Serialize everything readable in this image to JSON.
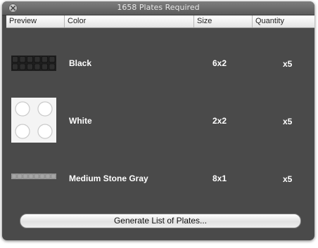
{
  "window": {
    "title": "1658 Plates Required"
  },
  "table": {
    "columns": [
      "Preview",
      "Color",
      "Size",
      "Quantity"
    ],
    "rows": [
      {
        "color": "Black",
        "size": "6x2",
        "quantity": "x5",
        "preview_color": "#1e1e1e"
      },
      {
        "color": "White",
        "size": "2x2",
        "quantity": "x5",
        "preview_color": "#f4f4f4"
      },
      {
        "color": "Medium Stone Gray",
        "size": "8x1",
        "quantity": "x5",
        "preview_color": "#9a9a9a"
      }
    ]
  },
  "generate_button": {
    "label": "Generate List of Plates..."
  }
}
